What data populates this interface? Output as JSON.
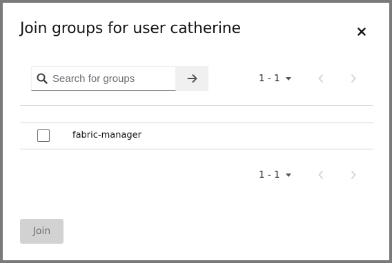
{
  "modal": {
    "title": "Join groups for user catherine",
    "close_icon": "close-icon"
  },
  "search": {
    "placeholder": "Search for groups",
    "value": "",
    "search_icon": "search-icon",
    "submit_icon": "arrow-right-icon"
  },
  "pagination_top": {
    "range": "1 - 1",
    "prev_icon": "chevron-left-icon",
    "next_icon": "chevron-right-icon"
  },
  "groups": [
    {
      "name": "fabric-manager",
      "checked": false
    }
  ],
  "pagination_bottom": {
    "range": "1 - 1",
    "prev_icon": "chevron-left-icon",
    "next_icon": "chevron-right-icon"
  },
  "footer": {
    "join_label": "Join",
    "join_disabled": true
  },
  "colors": {
    "backdrop": "#7a7a7a",
    "text": "#151515",
    "muted": "#6a6e73",
    "disabled_bg": "#d2d2d2",
    "divider": "#d2d2d2"
  }
}
